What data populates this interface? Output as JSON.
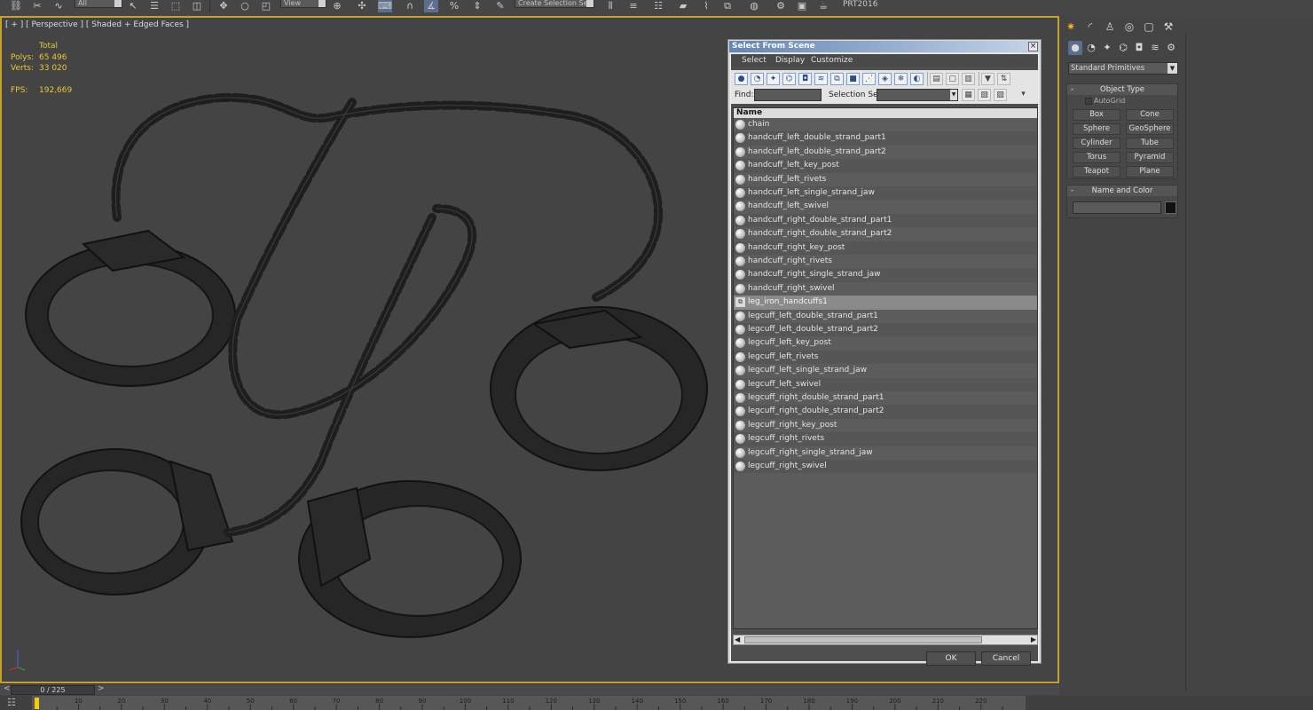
{
  "toolbar": {
    "filter_combo": "All",
    "view_combo": "View",
    "selection_set_combo": "Create Selection Se",
    "product_label": "PRT2016"
  },
  "viewport": {
    "label": "[ + ] [ Perspective ] [ Shaded + Edged Faces ]",
    "stats": {
      "total_label": "Total",
      "polys_label": "Polys:",
      "polys_value": "65 496",
      "verts_label": "Verts:",
      "verts_value": "33 020",
      "fps_label": "FPS:",
      "fps_value": "192,669"
    },
    "colors": {
      "stats_text": "#e8c832",
      "active_border": "#c8a02c",
      "background": "#444444"
    }
  },
  "time_slider": {
    "value": "0 / 225",
    "left_arrow": "<",
    "right_arrow": ">"
  },
  "track_bar": {
    "ticks": [
      "10",
      "20",
      "30",
      "40",
      "50",
      "60",
      "70",
      "80",
      "90",
      "100",
      "110",
      "120",
      "130",
      "140",
      "150",
      "160",
      "170",
      "180",
      "190",
      "200",
      "210",
      "220"
    ]
  },
  "command_panel": {
    "tabs": [
      "sun-icon",
      "curve-icon",
      "hierarchy-icon",
      "motion-icon",
      "display-icon",
      "hammer-icon"
    ],
    "subtabs": [
      "geometry-icon",
      "shapes-icon",
      "lights-icon",
      "cameras-icon",
      "helpers-icon",
      "spacewarps-icon",
      "systems-icon"
    ],
    "category": "Standard Primitives",
    "object_type": {
      "title": "Object Type",
      "autogrid": "AutoGrid",
      "buttons": [
        "Box",
        "Cone",
        "Sphere",
        "GeoSphere",
        "Cylinder",
        "Tube",
        "Torus",
        "Pyramid",
        "Teapot",
        "Plane"
      ]
    },
    "name_and_color": {
      "title": "Name and Color",
      "color": "#111111"
    }
  },
  "dialog": {
    "title": "Select From Scene",
    "close": "×",
    "menu": [
      "Select",
      "Display",
      "Customize"
    ],
    "find_label": "Find:",
    "selection_set_label": "Selection Set:",
    "column_header": "Name",
    "items": [
      "chain",
      "handcuff_left_double_strand_part1",
      "handcuff_left_double_strand_part2",
      "handcuff_left_key_post",
      "handcuff_left_rivets",
      "handcuff_left_single_strand_jaw",
      "handcuff_left_swivel",
      "handcuff_right_double_strand_part1",
      "handcuff_right_double_strand_part2",
      "handcuff_right_key_post",
      "handcuff_right_rivets",
      "handcuff_right_single_strand_jaw",
      "handcuff_right_swivel",
      "leg_iron_handcuffs1",
      "legcuff_left_double_strand_part1",
      "legcuff_left_double_strand_part2",
      "legcuff_left_key_post",
      "legcuff_left_rivets",
      "legcuff_left_single_strand_jaw",
      "legcuff_left_swivel",
      "legcuff_right_double_strand_part1",
      "legcuff_right_double_strand_part2",
      "legcuff_right_key_post",
      "legcuff_right_rivets",
      "legcuff_right_single_strand_jaw",
      "legcuff_right_swivel"
    ],
    "selected_item": "leg_iron_handcuffs1",
    "ok_label": "OK",
    "cancel_label": "Cancel"
  }
}
